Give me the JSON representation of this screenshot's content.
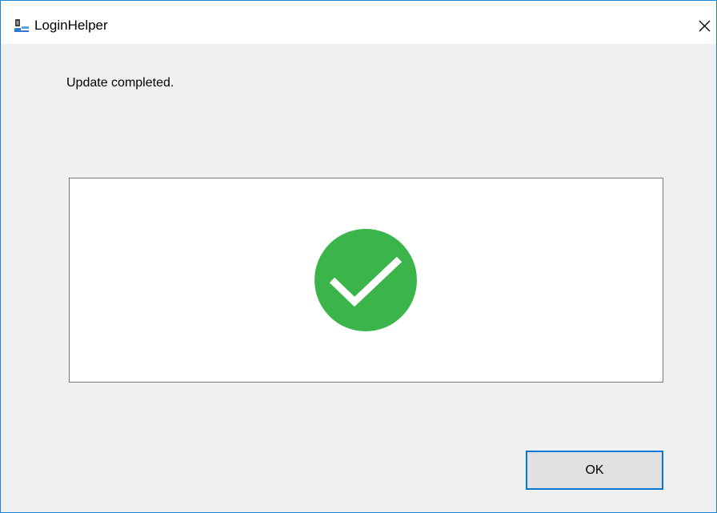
{
  "window": {
    "title": "LoginHelper",
    "icon": "login-helper-icon",
    "close_icon": "close-icon"
  },
  "dialog": {
    "message": "Update completed.",
    "status_icon": "checkmark-success-icon",
    "ok_label": "OK"
  },
  "colors": {
    "success_green": "#3bb54a",
    "accent_border": "#0078d7",
    "window_border": "#1883d7"
  }
}
